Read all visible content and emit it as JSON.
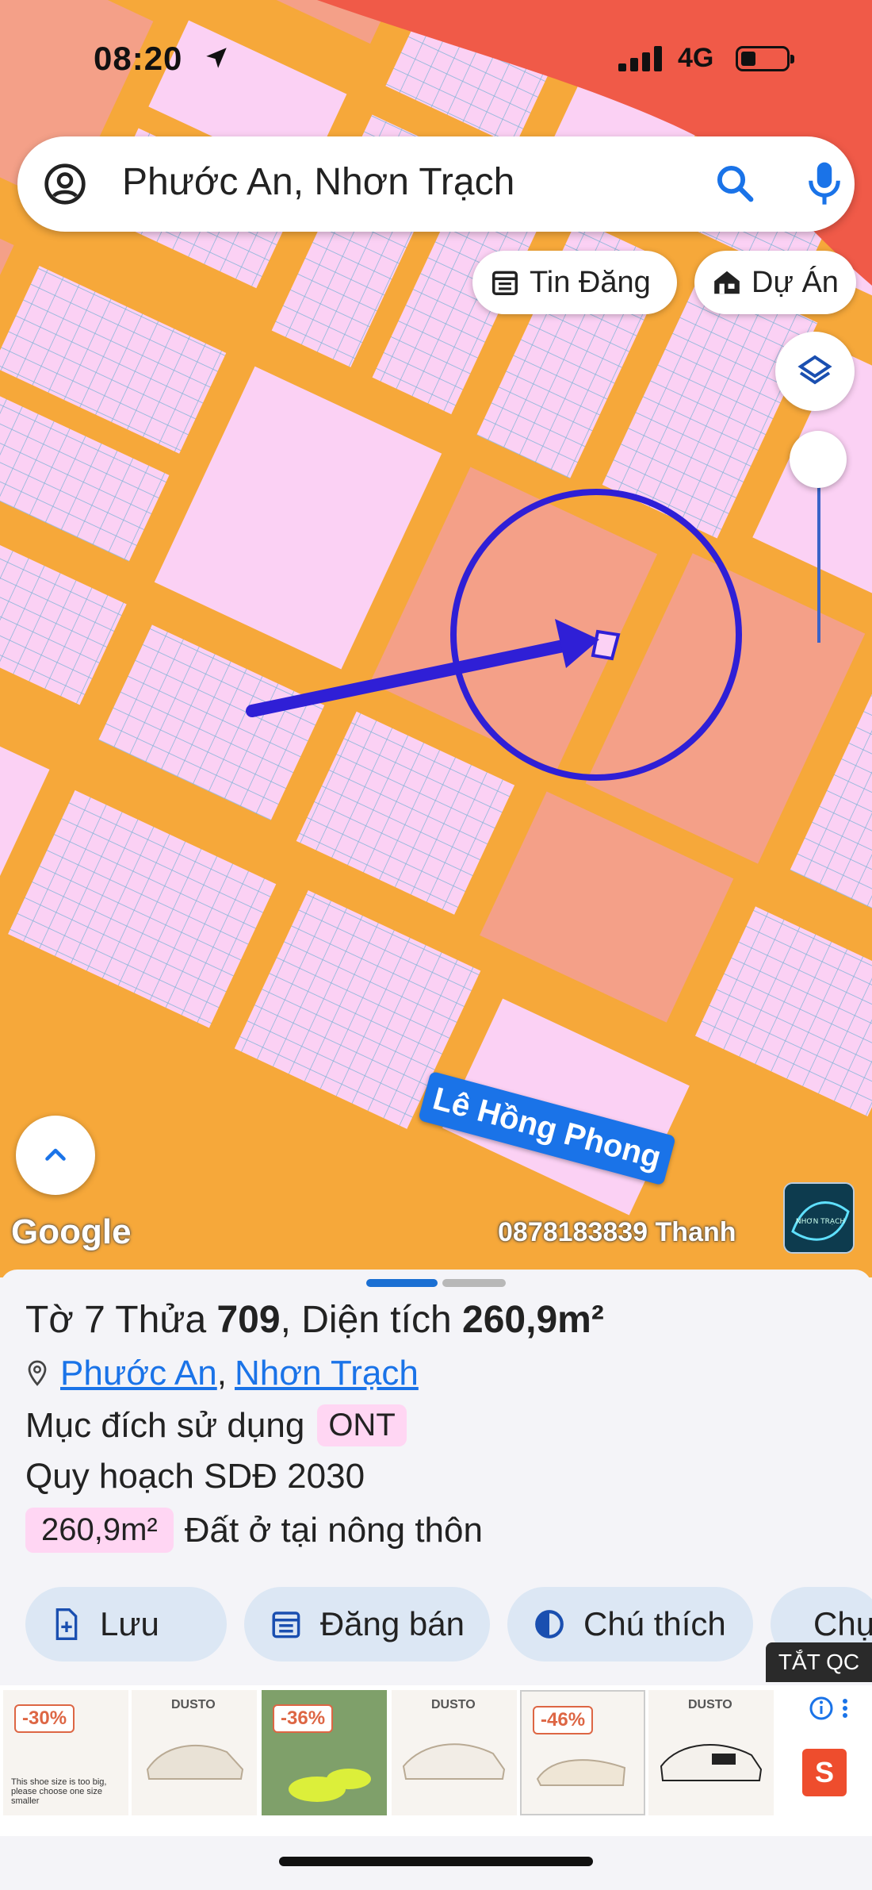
{
  "status_bar": {
    "time": "08:20",
    "network": "4G"
  },
  "search": {
    "query": "Phước An, Nhơn Trạch"
  },
  "chips": {
    "listings": "Tin Đăng",
    "projects": "Dự Án"
  },
  "map": {
    "street_label": "Lê Hồng Phong",
    "google_logo": "Google",
    "owner_text": "0878183839 Thanh",
    "thumb_text": "NHƠN TRẠCH"
  },
  "parcel": {
    "title_prefix": "Tờ 7 Thửa ",
    "parcel_number": "709",
    "title_mid": ", Diện tích ",
    "area": "260,9m²",
    "ward": "Phước An",
    "district": "Nhơn Trạch",
    "usage_label": "Mục đích sử dụng",
    "usage_code": "ONT",
    "planning_label": "Quy hoạch SDĐ 2030",
    "planning_area": "260,9m²",
    "planning_desc": "Đất ở tại nông thôn"
  },
  "actions": {
    "save": "Lưu",
    "post_sale": "Đăng bán",
    "legend": "Chú thích",
    "capture": "Chụp"
  },
  "ads": {
    "hide_label": "TẮT QC",
    "brand": "DUSTO",
    "discounts": [
      "-30%",
      "-36%",
      "-46%"
    ],
    "shop_glyph": "S",
    "size_note": "This shoe size is too big, please choose one size smaller"
  },
  "colors": {
    "road": "#f6a83a",
    "lot_pink": "#fbd1f4",
    "lot_salmon": "#f4a088",
    "accent": "#1a73e8",
    "marker": "#2f1fd6",
    "alert_red": "#f05a48"
  }
}
